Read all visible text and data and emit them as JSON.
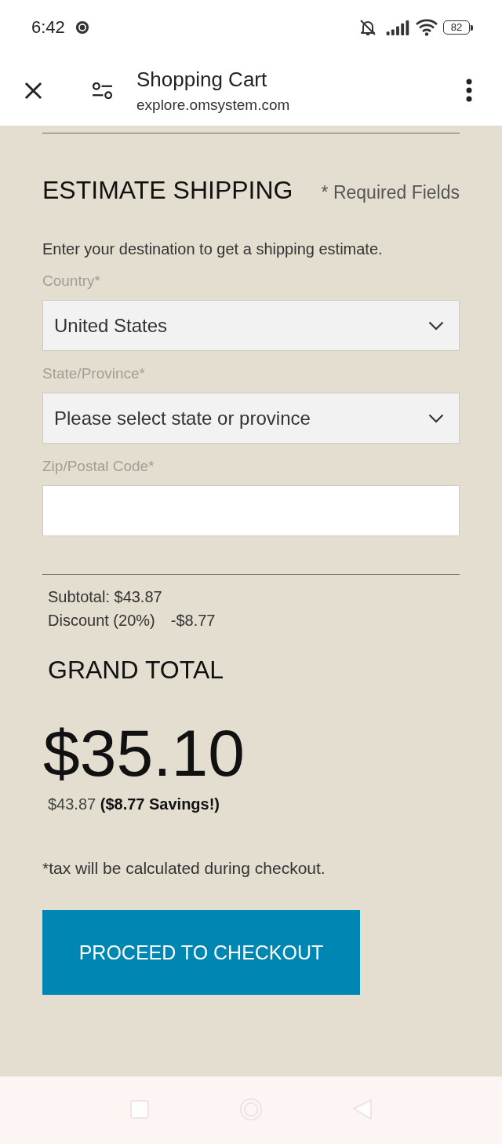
{
  "status_bar": {
    "time": "6:42",
    "battery": "82"
  },
  "browser_bar": {
    "title": "Shopping Cart",
    "url": "explore.omsystem.com"
  },
  "estimate_shipping": {
    "heading": "ESTIMATE SHIPPING",
    "required_note": "* Required Fields",
    "instructions": "Enter your destination to get a shipping estimate.",
    "fields": [
      {
        "kind": "select",
        "label": "Country*",
        "value": "United States"
      },
      {
        "kind": "select",
        "label": "State/Province*",
        "value": "Please select state or province"
      },
      {
        "kind": "text",
        "label": "Zip/Postal Code*"
      }
    ]
  },
  "totals": {
    "subtotal": "Subtotal: $43.87",
    "discount_label": "Discount (20%)",
    "discount_amount": "-$8.77",
    "grand_total_label": "GRAND TOTAL",
    "grand_total": "$35.10",
    "savings": "$43.87 **($8.77 Savings!)**",
    "tax_note": "*tax will be calculated during checkout."
  },
  "checkout_button": {
    "label": "PROCEED TO CHECKOUT"
  }
}
